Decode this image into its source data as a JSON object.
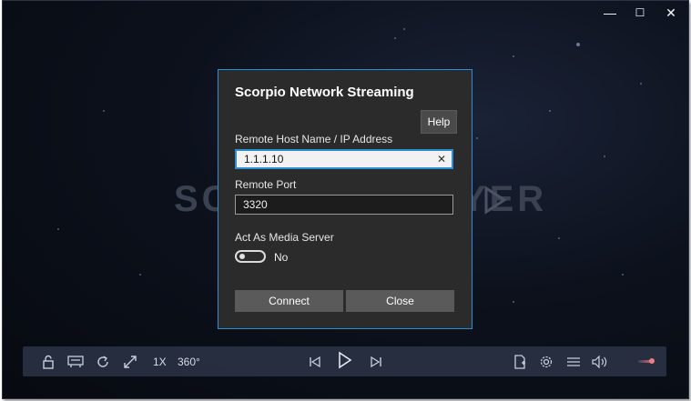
{
  "window": {
    "minimize_glyph": "—",
    "maximize_glyph": "☐",
    "close_glyph": "✕"
  },
  "background": {
    "watermark": "SCORPIO PLAYER"
  },
  "dialog": {
    "title": "Scorpio Network Streaming",
    "help_label": "Help",
    "host": {
      "label": "Remote Host Name / IP Address",
      "value": "1.1.1.10",
      "clear_glyph": "✕"
    },
    "port": {
      "label": "Remote Port",
      "value": "3320"
    },
    "media_server": {
      "label": "Act As Media Server",
      "state_text": "No",
      "on": false
    },
    "connect_label": "Connect",
    "close_label": "Close",
    "accent_color": "#2a8fd6"
  },
  "controls": {
    "speed": "1X",
    "degrees": "360°",
    "icons": [
      "lock-icon",
      "subtitles-icon",
      "repeat-icon",
      "fullscreen-icon",
      "previous-icon",
      "play-icon",
      "next-icon",
      "open-file-icon",
      "settings-icon",
      "playlist-icon",
      "volume-icon"
    ],
    "volume_level": 0.8,
    "volume_color": "#f07c84"
  }
}
